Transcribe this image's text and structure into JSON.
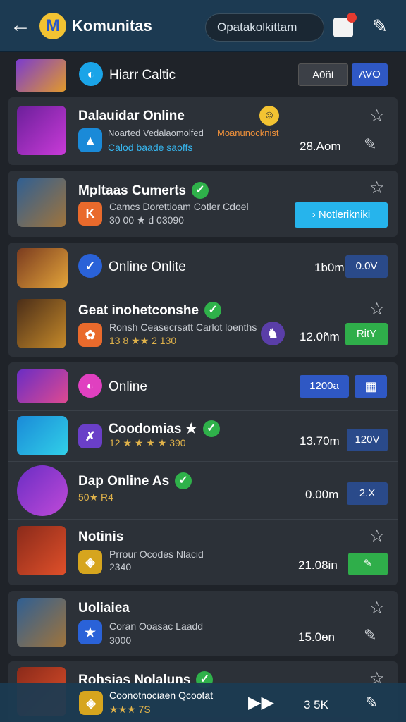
{
  "header": {
    "title": "Komunitas",
    "search_placeholder": "Opatakolkittam",
    "back_icon": "back-arrow-icon",
    "logo_icon": "app-logo-icon"
  },
  "strip": {
    "name": "Hiarr Caltic",
    "button_a": "A0ñt",
    "button_b": "AVO"
  },
  "cards": [
    {
      "title": "Dalauidar Online",
      "line1": "Noarted Vedalaomolfed",
      "line1_accent": "Moanunocknist",
      "line2": "Calod baade saoffs",
      "count": "28.Aom"
    },
    {
      "title": "Mpltaas Cumerts",
      "line1": "Camcs Dorettioam Cotler Cdoel",
      "line2": "30 00 ★ d 03090",
      "action": "Notlerikniki"
    },
    {
      "title": "Online Onlite",
      "count": "1b0m",
      "button": "0.0V"
    },
    {
      "title": "Geat inohetconshe",
      "line1": "Ronsh Ceasecrsatt Carlot loenths",
      "line2": "13 8 ★★ 2 130",
      "count": "12.0ñm",
      "button": "RitY"
    },
    {
      "title": "Online",
      "button": "1200a"
    },
    {
      "title": "Coodomias ★",
      "line2": "12 ★ ★ ★ ★ 390",
      "count": "13.70m",
      "button": "120V"
    },
    {
      "title": "Dap Online As",
      "line2": "50★ R4",
      "count": "0.00m",
      "button": "2.X"
    },
    {
      "title": "Notinis",
      "line1": "Prrour Ocodes Nlacid",
      "line2": "2340",
      "count": "21.08in"
    },
    {
      "title": "Uoliaiea",
      "line1": "Coran Ooasac Laadd",
      "line2": "3000",
      "count": "15.0ɵn"
    },
    {
      "title": "Rohsias Nolaluns",
      "line1": "Coonotnociaen Qcootat",
      "line2": "★★★ 7S",
      "count": "3 5K"
    }
  ],
  "colors": {
    "accent": "#2f58c4",
    "green": "#2fae4a",
    "cyan": "#26b4ec",
    "header": "#1c3a52"
  }
}
